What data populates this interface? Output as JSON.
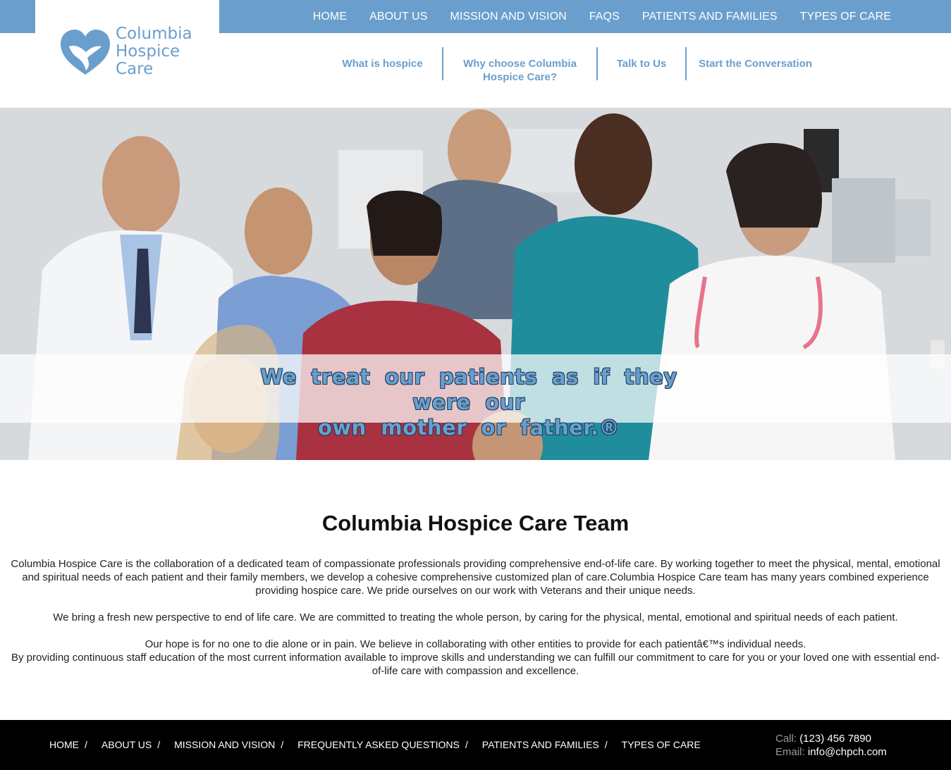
{
  "logo": {
    "line1": "Columbia",
    "line2": "Hospice",
    "line3": "Care",
    "icon": "heart-dove-icon",
    "color": "#6a9fcd"
  },
  "main_nav": [
    "HOME",
    "ABOUT US",
    "MISSION AND VISION",
    "FAQS",
    "PATIENTS AND FAMILIES",
    "TYPES OF CARE"
  ],
  "sub_nav": {
    "item1": "What is hospice",
    "item2_line1": "Why choose Columbia",
    "item2_line2": "Hospice Care?",
    "item3": "Talk to Us",
    "item4": "Start the Conversation"
  },
  "hero": {
    "line1": "We treat our patients as if they were our",
    "line2": "own mother or father.®"
  },
  "content": {
    "title": "Columbia Hospice Care Team",
    "p1": "Columbia Hospice Care is the collaboration of a dedicated team of compassionate professionals providing comprehensive end-of-life care. By working together to meet the physical, mental, emotional and spiritual needs of each patient and their family members, we develop a cohesive comprehensive customized plan of care.Columbia Hospice Care team has many years combined experience providing hospice care. We pride ourselves on our work with Veterans and their unique needs.",
    "p2": "We bring a fresh new perspective to end of life care. We are committed to treating the whole person, by caring for the physical, mental, emotional and spiritual needs of each patient.",
    "p3": "Our hope is for no one to die alone or in pain. We believe in collaborating with other entities to provide for each patientâ€™s individual needs.",
    "p4": "By providing continuous staff education of the most current information available to improve skills and understanding we can fulfill our commitment to care for you or your loved one with essential end-of-life care with compassion and excellence."
  },
  "footer": {
    "nav": [
      "HOME",
      "ABOUT US",
      "MISSION AND VISION",
      "FREQUENTLY ASKED QUESTIONS",
      "PATIENTS AND FAMILIES",
      "TYPES OF CARE"
    ],
    "separator": "/",
    "call_label": "Call:",
    "call_value": "(123) 456 7890",
    "email_label": "Email:",
    "email_value": "info@chpch.com"
  },
  "colors": {
    "brand_blue": "#6a9fcd",
    "footer_bg": "#000000"
  }
}
